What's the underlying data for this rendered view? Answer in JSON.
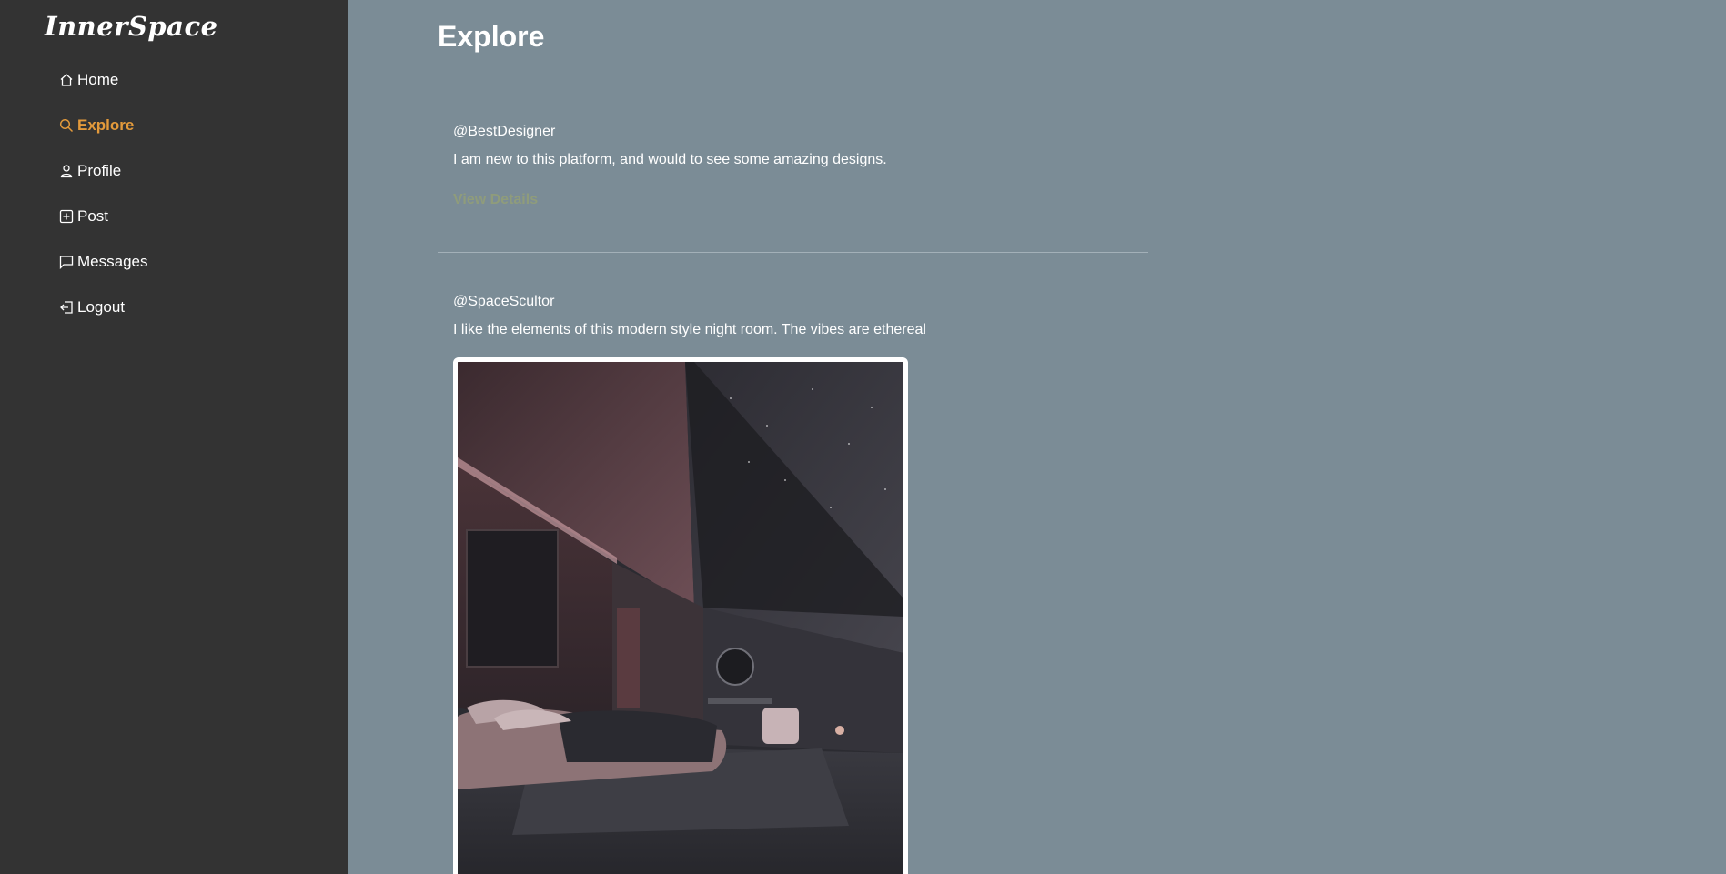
{
  "app": {
    "logo": "InnerSpace"
  },
  "sidebar": {
    "items": [
      {
        "label": "Home",
        "icon": "home-icon",
        "active": false
      },
      {
        "label": "Explore",
        "icon": "search-icon",
        "active": true
      },
      {
        "label": "Profile",
        "icon": "user-icon",
        "active": false
      },
      {
        "label": "Post",
        "icon": "plus-square-icon",
        "active": false
      },
      {
        "label": "Messages",
        "icon": "message-icon",
        "active": false
      },
      {
        "label": "Logout",
        "icon": "logout-icon",
        "active": false
      }
    ]
  },
  "main": {
    "title": "Explore",
    "posts": [
      {
        "username": "@BestDesigner",
        "text": "I am new to this platform, and would to see some amazing designs.",
        "link": "View Details"
      },
      {
        "username": "@SpaceScultor",
        "text": "I like the elements of this modern style night room. The vibes are ethereal"
      }
    ]
  },
  "colors": {
    "sidebar_bg": "#333333",
    "main_bg": "#7b8c96",
    "accent": "#e39a3b",
    "link": "#8f9c7b"
  }
}
